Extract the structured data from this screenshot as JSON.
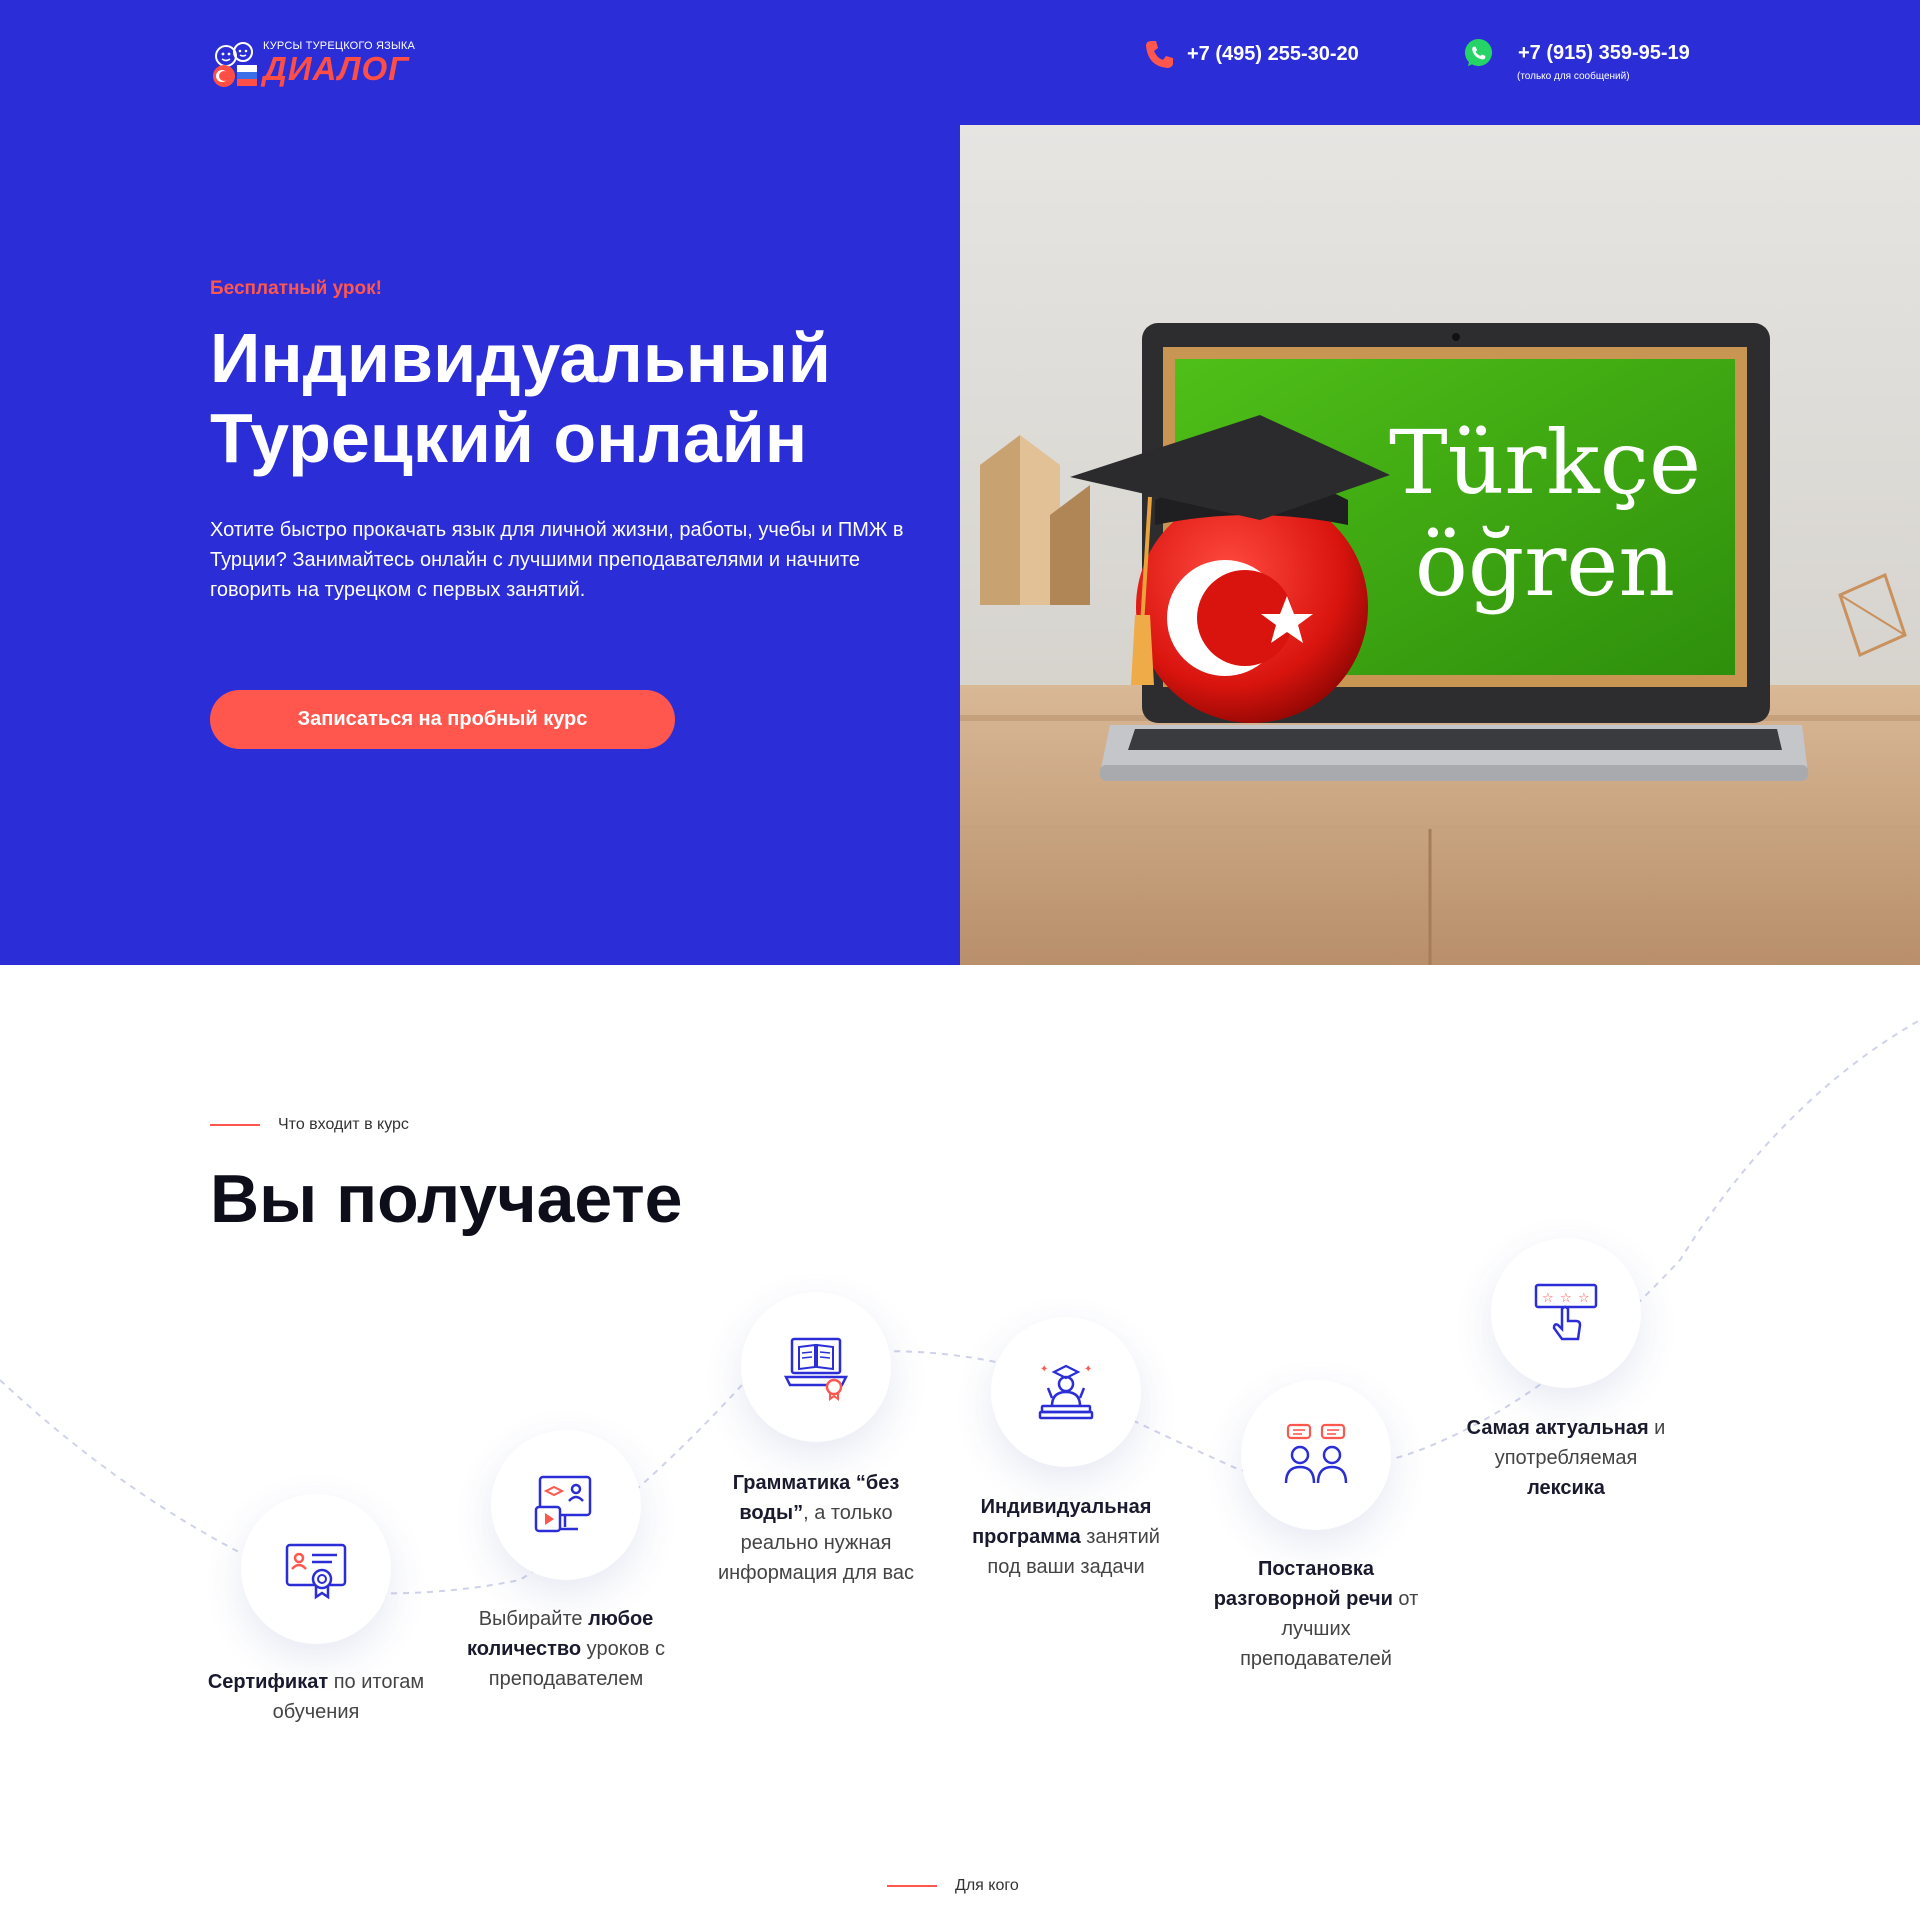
{
  "header": {
    "logo": {
      "small_text": "КУРСЫ ТУРЕЦКОГО ЯЗЫКА",
      "big_text": "ДИАЛОГ"
    },
    "phone_main": "+7 (495) 255-30-20",
    "phone_whatsapp": "+7 (915) 359-95-19",
    "phone_whatsapp_note": "(только для сообщений)"
  },
  "hero": {
    "eyebrow": "Бесплатный урок!",
    "title": "Индивидуальный Турецкий онлайн",
    "description": "Хотите быстро прокачать язык для личной жизни, работы, учебы и ПМЖ в Турции? Занимайтесь онлайн с лучшими преподавателями и начните говорить на турецком с первых занятий.",
    "cta_label": "Записаться на пробный курс",
    "image_text_line1": "Türkçe",
    "image_text_line2": "öğren"
  },
  "course_section": {
    "eyebrow": "Что входит в курс",
    "title": "Вы получаете",
    "features": [
      {
        "icon": "certificate-icon",
        "bold": "Сертификат",
        "rest": " по итогам обучения"
      },
      {
        "icon": "video-lesson-icon",
        "pre": "Выбирайте ",
        "bold": "любое количество",
        "rest": " уроков с преподавателем"
      },
      {
        "icon": "laptop-book-icon",
        "bold": "Грамматика “без воды”",
        "rest": ", а только реально нужная информация для вас"
      },
      {
        "icon": "graduate-icon",
        "bold": "Индивидуальная программа",
        "rest": " занятий под ваши задачи"
      },
      {
        "icon": "conversation-icon",
        "bold": "Постановка разговорной речи",
        "rest": " от лучших преподавателей"
      },
      {
        "icon": "rating-click-icon",
        "bold": "Самая актуальная",
        "mid": " и употребляемая ",
        "bold2": "лексика"
      }
    ]
  },
  "next_section": {
    "eyebrow": "Для кого"
  },
  "colors": {
    "brand_blue": "#2b2ed6",
    "accent_red": "#ff574e",
    "whatsapp_green": "#25d366",
    "icon_blue": "#2b2ed6"
  }
}
